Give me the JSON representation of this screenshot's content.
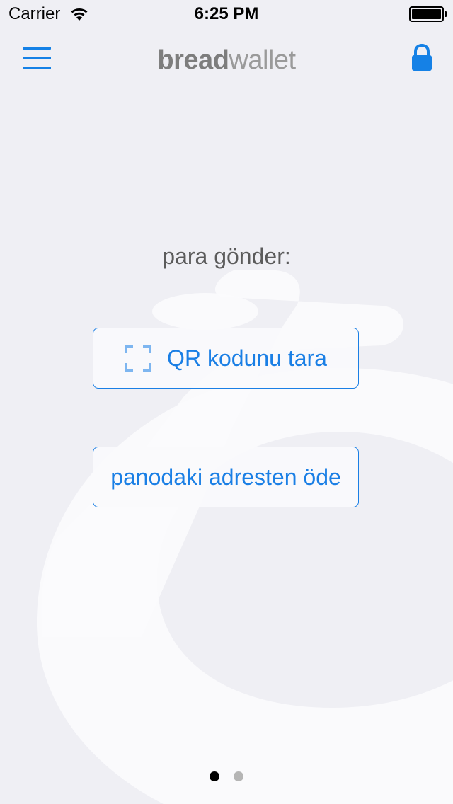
{
  "status_bar": {
    "carrier": "Carrier",
    "time": "6:25 PM"
  },
  "nav": {
    "logo_bold": "bread",
    "logo_light": "wallet",
    "menu_icon": "hamburger-menu-icon",
    "lock_icon": "lock-icon"
  },
  "send": {
    "title": "para gönder:",
    "scan_qr_label": "QR kodunu tara",
    "scan_icon": "qr-scan-icon",
    "pay_clipboard_label": "panodaki adresten öde"
  },
  "pager": {
    "page_count": 2,
    "current_page": 1
  },
  "colors": {
    "accent": "#1a7fe5",
    "background": "#efeff4",
    "title_text": "#5b5b5b"
  }
}
